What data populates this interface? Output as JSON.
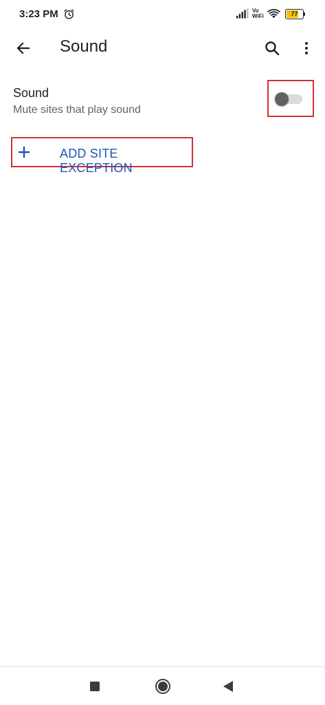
{
  "status_bar": {
    "time": "3:23 PM",
    "vo_label": "Vo",
    "wifi_label": "WiFi",
    "battery_level": "77",
    "battery_fraction": 0.77,
    "icons": [
      "alarm-icon",
      "signal-icon",
      "wifi-icon",
      "battery-icon"
    ]
  },
  "toolbar": {
    "title": "Sound",
    "icons": [
      "back-arrow-icon",
      "search-icon",
      "more-vert-icon"
    ]
  },
  "sound_setting": {
    "title": "Sound",
    "summary": "Mute sites that play sound",
    "enabled": false
  },
  "add_exception": {
    "label": "ADD SITE EXCEPTION",
    "icon": "plus-icon"
  },
  "nav_bar": {
    "icons": [
      "recents-icon",
      "home-icon",
      "back-icon"
    ]
  },
  "colors": {
    "accent": "#1a57b8",
    "highlight": "#d32f2f",
    "battery": "#f2c200",
    "toggle_thumb": "#616161",
    "toggle_track": "#dcdcdc"
  }
}
